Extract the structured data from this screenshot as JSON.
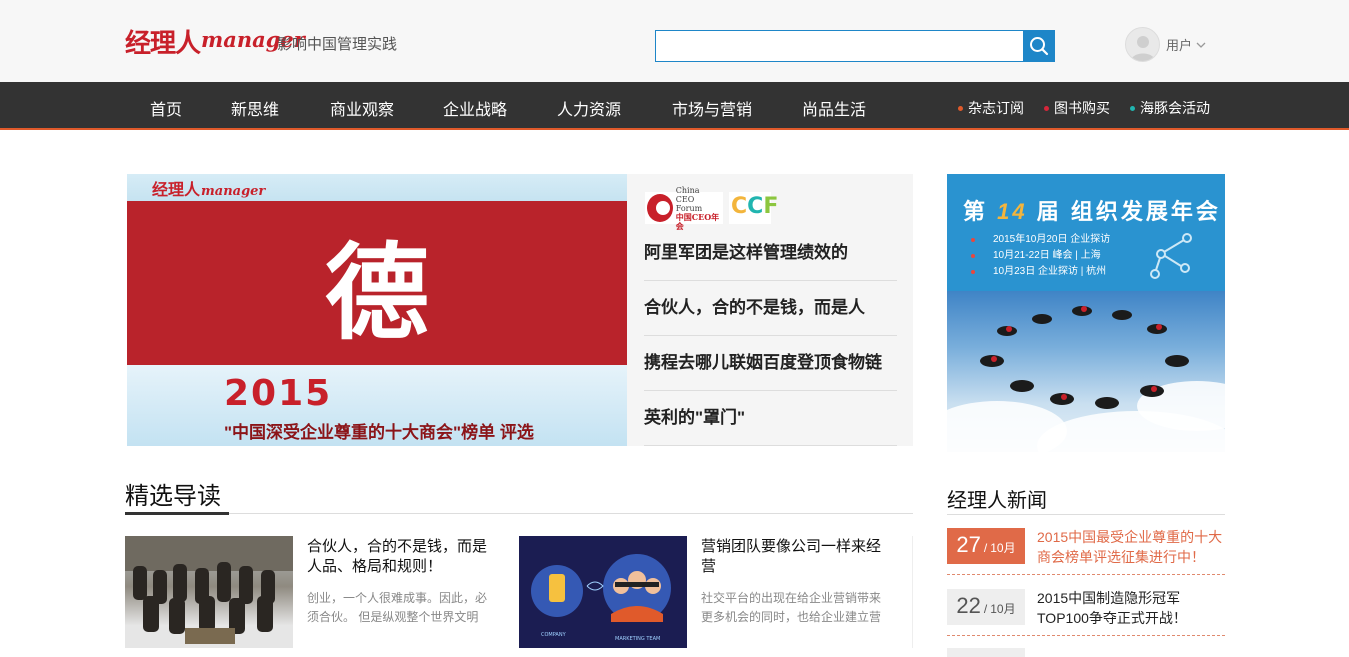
{
  "header": {
    "logo_cn": "经理人",
    "logo_en": "manager",
    "slogan": "影响中国管理实践",
    "search": {
      "value": "",
      "placeholder": ""
    },
    "user_label": "用户"
  },
  "nav": {
    "items": [
      "首页",
      "新思维",
      "商业观察",
      "企业战略",
      "人力资源",
      "市场与营销",
      "尚品生活"
    ],
    "extras": [
      {
        "label": "杂志订阅",
        "color": "#e05a2b"
      },
      {
        "label": "图书购买",
        "color": "#d6263a"
      },
      {
        "label": "海豚会活动",
        "color": "#21b5b0"
      }
    ]
  },
  "banner": {
    "logo_cn": "经理人",
    "logo_en": "manager",
    "big_char": "德",
    "year": "2015",
    "subtitle": "\"中国深受企业尊重的十大商会\"榜单 评选"
  },
  "forum": {
    "ceo_line1": "China",
    "ceo_line2": "CEO Forum",
    "ceo_line3": "中国CEO年会",
    "ccf": "CCF"
  },
  "headlines": [
    "阿里军团是这样管理绩效的",
    "合伙人，合的不是钱，而是人",
    "携程去哪儿联姻百度登顶食物链",
    "英利的\"罩门\""
  ],
  "side_ad": {
    "title_pre": "第",
    "title_num": "14",
    "title_post": "届 组织发展年会",
    "dates": [
      "2015年10月20日 企业探访",
      "10月21-22日 峰会 | 上海",
      "10月23日 企业探访 | 杭州"
    ]
  },
  "featured": {
    "title": "精选导读",
    "cards": [
      {
        "title": "合伙人，合的不是钱，而是人品、格局和规则！",
        "desc": "创业，一个人很难成事。因此，必须合伙。 但是纵观整个世界文明"
      },
      {
        "title": "营销团队要像公司一样来经营",
        "desc": "社交平台的出现在给企业营销带来更多机会的同时，也给企业建立营",
        "img_label_1": "COMPANY",
        "img_label_2": "MARKETING TEAM"
      }
    ]
  },
  "news": {
    "title": "经理人新闻",
    "items": [
      {
        "day": "27",
        "month": "10月",
        "text": "2015中国最受企业尊重的十大商会榜单评选征集进行中！",
        "highlight": true
      },
      {
        "day": "22",
        "month": "10月",
        "text": "2015中国制造隐形冠军TOP100争夺正式开战！",
        "highlight": false
      }
    ]
  },
  "colors": {
    "brand_red": "#c8202a",
    "nav_bg": "#333333",
    "nav_accent": "#e05a2b",
    "search_blue": "#1e86c8",
    "news_accent": "#e06a48"
  }
}
